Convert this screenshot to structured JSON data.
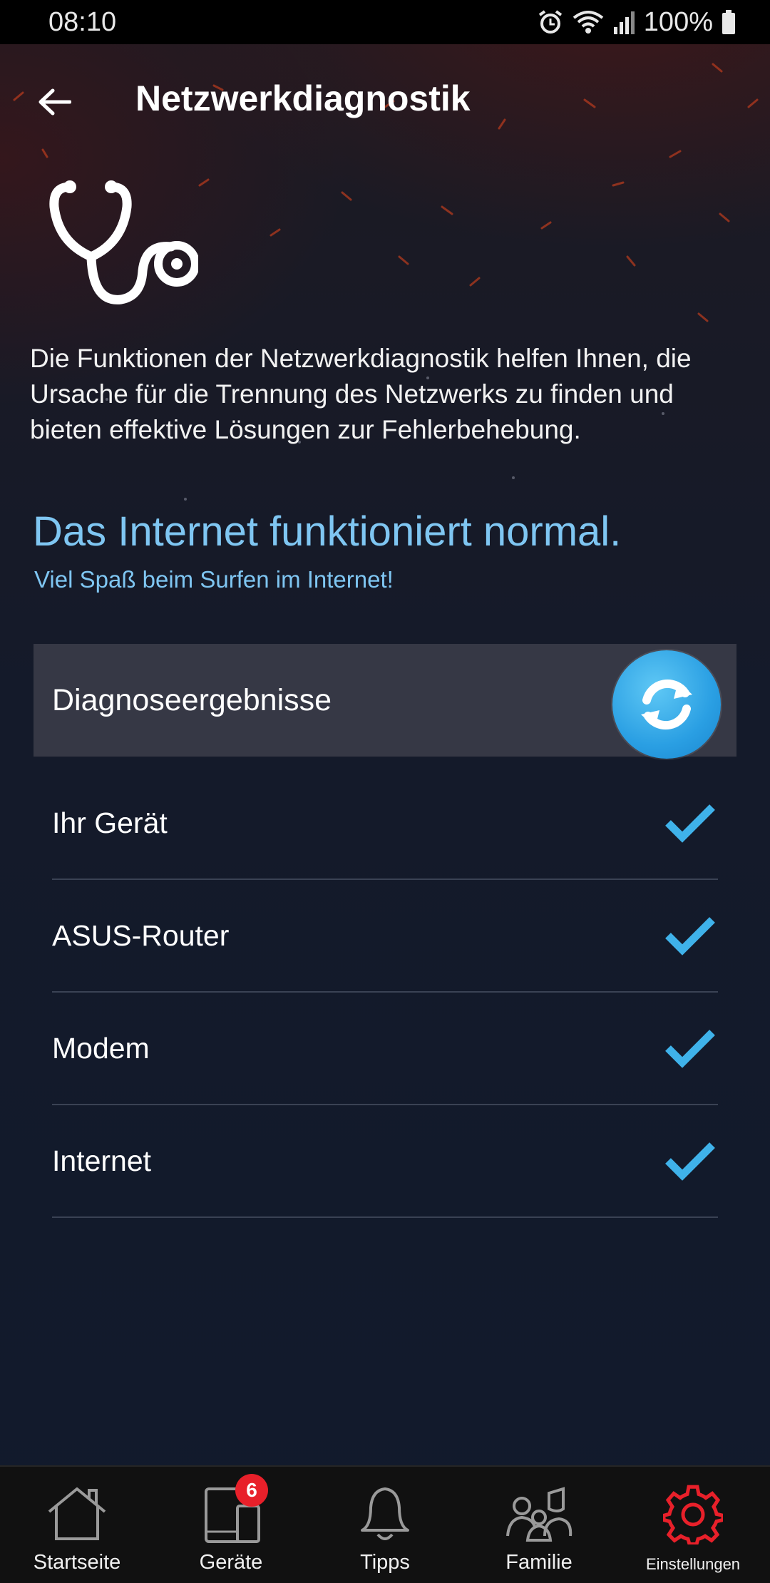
{
  "status_bar": {
    "time": "08:10",
    "battery": "100%"
  },
  "header": {
    "title": "Netzwerkdiagnostik"
  },
  "description": "Die Funktionen der Netzwerkdiagnostik helfen Ihnen, die Ursache für die Trennung des Netzwerks zu finden und bieten effektive Lösungen zur Fehlerbehebung.",
  "status": {
    "title": "Das Internet funktioniert normal.",
    "subtitle": "Viel Spaß beim Surfen im Internet!"
  },
  "results": {
    "header": "Diagnoseergebnisse",
    "items": [
      {
        "label": "Ihr Gerät",
        "status": "ok"
      },
      {
        "label": "ASUS-Router",
        "status": "ok"
      },
      {
        "label": "Modem",
        "status": "ok"
      },
      {
        "label": "Internet",
        "status": "ok"
      }
    ]
  },
  "nav": {
    "items": [
      {
        "label": "Startseite",
        "icon": "home-icon"
      },
      {
        "label": "Geräte",
        "icon": "devices-icon",
        "badge": "6"
      },
      {
        "label": "Tipps",
        "icon": "bell-icon"
      },
      {
        "label": "Familie",
        "icon": "family-icon"
      },
      {
        "label": "Einstellungen",
        "icon": "gear-icon",
        "active": true
      }
    ]
  },
  "colors": {
    "accent": "#7fc6f2",
    "check": "#3fb2ea",
    "active_nav": "#e8202a",
    "badge": "#e8202a"
  }
}
